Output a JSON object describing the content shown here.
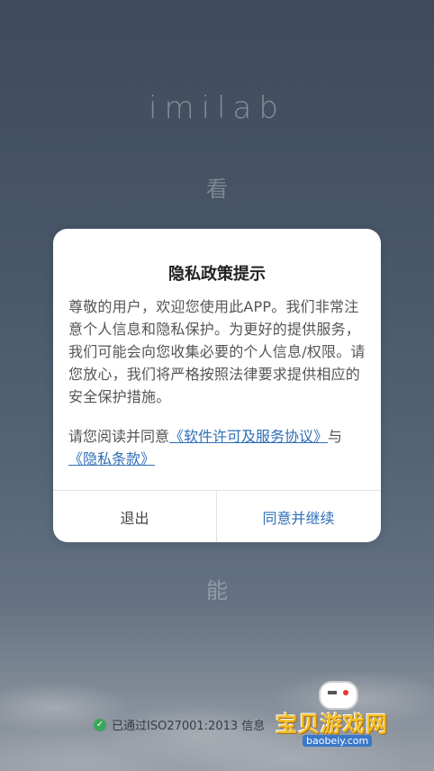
{
  "background": {
    "logo_text": "imilab",
    "slogan_top": "看",
    "slogan_bottom": "能",
    "certification_text": "已通过ISO27001:2013 信息"
  },
  "dialog": {
    "title": "隐私政策提示",
    "body": "尊敬的用户，欢迎您使用此APP。我们非常注意个人信息和隐私保护。为更好的提供服务，我们可能会向您收集必要的个人信息/权限。请您放心，我们将严格按照法律要求提供相应的安全保护措施。",
    "agree_prefix": "请您阅读并同意",
    "license_link": "《软件许可及服务协议》",
    "agree_middle": "与",
    "privacy_link": "《隐私条款》",
    "exit_label": "退出",
    "agree_label": "同意并继续"
  },
  "watermark": {
    "text": "宝贝游戏网",
    "url": "baobeiy.com"
  },
  "colors": {
    "link": "#2f6fb7",
    "check": "#3aa55a",
    "watermark": "#f2c230"
  }
}
